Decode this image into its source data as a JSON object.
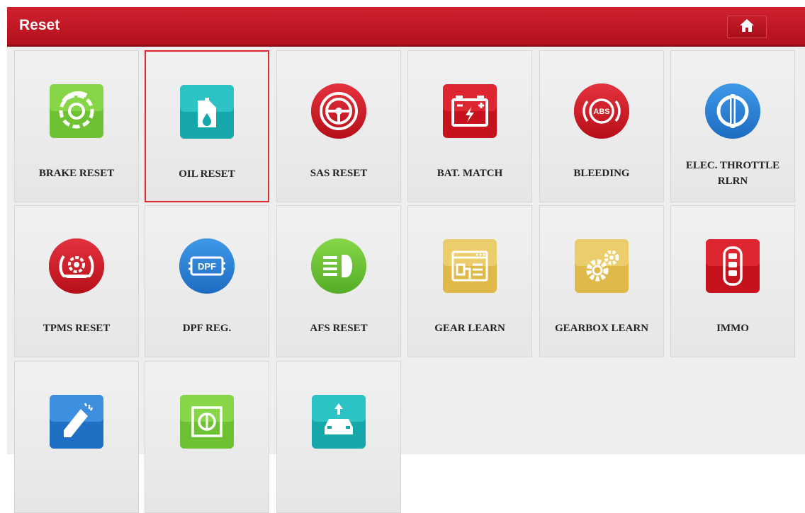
{
  "header": {
    "title": "Reset"
  },
  "icons": {
    "home": "home-icon"
  },
  "colors": {
    "header_red": "#c41a27",
    "selection_border": "#e0282e",
    "green": "#7ccf38",
    "teal": "#22b7b8",
    "red": "#d3202b",
    "blue": "#2f87d9",
    "yellow": "#e8c85a"
  },
  "tiles": [
    {
      "label": "BRAKE RESET",
      "icon": "brake-disc-icon",
      "selected": false
    },
    {
      "label": "OIL RESET",
      "icon": "oil-can-icon",
      "selected": true
    },
    {
      "label": "SAS RESET",
      "icon": "steering-wheel-icon",
      "selected": false
    },
    {
      "label": "BAT. MATCH",
      "icon": "battery-icon",
      "selected": false
    },
    {
      "label": "BLEEDING",
      "icon": "abs-icon",
      "selected": false
    },
    {
      "label": "ELEC. THROTTLE RLRN",
      "icon": "throttle-icon",
      "selected": false
    },
    {
      "label": "TPMS RESET",
      "icon": "tire-pressure-icon",
      "selected": false
    },
    {
      "label": "DPF REG.",
      "icon": "dpf-icon",
      "selected": false
    },
    {
      "label": "AFS RESET",
      "icon": "headlight-icon",
      "selected": false
    },
    {
      "label": "GEAR LEARN",
      "icon": "gear-window-icon",
      "selected": false
    },
    {
      "label": "GEARBOX LEARN",
      "icon": "gears-icon",
      "selected": false
    },
    {
      "label": "IMMO",
      "icon": "car-key-icon",
      "selected": false
    },
    {
      "label": "",
      "icon": "injector-icon",
      "selected": false
    },
    {
      "label": "",
      "icon": "suspension-icon",
      "selected": false
    },
    {
      "label": "",
      "icon": "car-lift-icon",
      "selected": false
    }
  ]
}
